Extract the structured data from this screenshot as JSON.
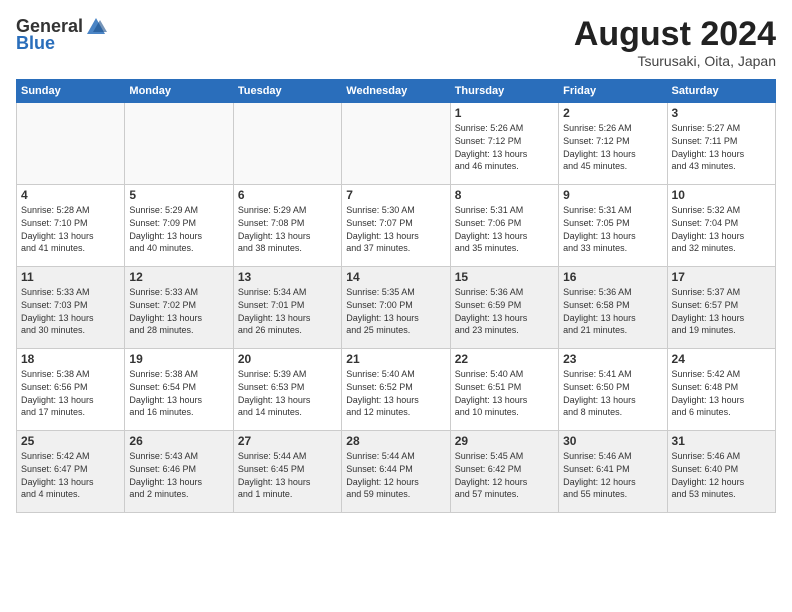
{
  "header": {
    "logo_general": "General",
    "logo_blue": "Blue",
    "month_title": "August 2024",
    "location": "Tsurusaki, Oita, Japan"
  },
  "weekdays": [
    "Sunday",
    "Monday",
    "Tuesday",
    "Wednesday",
    "Thursday",
    "Friday",
    "Saturday"
  ],
  "weeks": [
    [
      {
        "day": "",
        "empty": true
      },
      {
        "day": "",
        "empty": true
      },
      {
        "day": "",
        "empty": true
      },
      {
        "day": "",
        "empty": true
      },
      {
        "day": "1",
        "info": "Sunrise: 5:26 AM\nSunset: 7:12 PM\nDaylight: 13 hours\nand 46 minutes."
      },
      {
        "day": "2",
        "info": "Sunrise: 5:26 AM\nSunset: 7:12 PM\nDaylight: 13 hours\nand 45 minutes."
      },
      {
        "day": "3",
        "info": "Sunrise: 5:27 AM\nSunset: 7:11 PM\nDaylight: 13 hours\nand 43 minutes."
      }
    ],
    [
      {
        "day": "4",
        "info": "Sunrise: 5:28 AM\nSunset: 7:10 PM\nDaylight: 13 hours\nand 41 minutes."
      },
      {
        "day": "5",
        "info": "Sunrise: 5:29 AM\nSunset: 7:09 PM\nDaylight: 13 hours\nand 40 minutes."
      },
      {
        "day": "6",
        "info": "Sunrise: 5:29 AM\nSunset: 7:08 PM\nDaylight: 13 hours\nand 38 minutes."
      },
      {
        "day": "7",
        "info": "Sunrise: 5:30 AM\nSunset: 7:07 PM\nDaylight: 13 hours\nand 37 minutes."
      },
      {
        "day": "8",
        "info": "Sunrise: 5:31 AM\nSunset: 7:06 PM\nDaylight: 13 hours\nand 35 minutes."
      },
      {
        "day": "9",
        "info": "Sunrise: 5:31 AM\nSunset: 7:05 PM\nDaylight: 13 hours\nand 33 minutes."
      },
      {
        "day": "10",
        "info": "Sunrise: 5:32 AM\nSunset: 7:04 PM\nDaylight: 13 hours\nand 32 minutes."
      }
    ],
    [
      {
        "day": "11",
        "info": "Sunrise: 5:33 AM\nSunset: 7:03 PM\nDaylight: 13 hours\nand 30 minutes."
      },
      {
        "day": "12",
        "info": "Sunrise: 5:33 AM\nSunset: 7:02 PM\nDaylight: 13 hours\nand 28 minutes."
      },
      {
        "day": "13",
        "info": "Sunrise: 5:34 AM\nSunset: 7:01 PM\nDaylight: 13 hours\nand 26 minutes."
      },
      {
        "day": "14",
        "info": "Sunrise: 5:35 AM\nSunset: 7:00 PM\nDaylight: 13 hours\nand 25 minutes."
      },
      {
        "day": "15",
        "info": "Sunrise: 5:36 AM\nSunset: 6:59 PM\nDaylight: 13 hours\nand 23 minutes."
      },
      {
        "day": "16",
        "info": "Sunrise: 5:36 AM\nSunset: 6:58 PM\nDaylight: 13 hours\nand 21 minutes."
      },
      {
        "day": "17",
        "info": "Sunrise: 5:37 AM\nSunset: 6:57 PM\nDaylight: 13 hours\nand 19 minutes."
      }
    ],
    [
      {
        "day": "18",
        "info": "Sunrise: 5:38 AM\nSunset: 6:56 PM\nDaylight: 13 hours\nand 17 minutes."
      },
      {
        "day": "19",
        "info": "Sunrise: 5:38 AM\nSunset: 6:54 PM\nDaylight: 13 hours\nand 16 minutes."
      },
      {
        "day": "20",
        "info": "Sunrise: 5:39 AM\nSunset: 6:53 PM\nDaylight: 13 hours\nand 14 minutes."
      },
      {
        "day": "21",
        "info": "Sunrise: 5:40 AM\nSunset: 6:52 PM\nDaylight: 13 hours\nand 12 minutes."
      },
      {
        "day": "22",
        "info": "Sunrise: 5:40 AM\nSunset: 6:51 PM\nDaylight: 13 hours\nand 10 minutes."
      },
      {
        "day": "23",
        "info": "Sunrise: 5:41 AM\nSunset: 6:50 PM\nDaylight: 13 hours\nand 8 minutes."
      },
      {
        "day": "24",
        "info": "Sunrise: 5:42 AM\nSunset: 6:48 PM\nDaylight: 13 hours\nand 6 minutes."
      }
    ],
    [
      {
        "day": "25",
        "info": "Sunrise: 5:42 AM\nSunset: 6:47 PM\nDaylight: 13 hours\nand 4 minutes."
      },
      {
        "day": "26",
        "info": "Sunrise: 5:43 AM\nSunset: 6:46 PM\nDaylight: 13 hours\nand 2 minutes."
      },
      {
        "day": "27",
        "info": "Sunrise: 5:44 AM\nSunset: 6:45 PM\nDaylight: 13 hours\nand 1 minute."
      },
      {
        "day": "28",
        "info": "Sunrise: 5:44 AM\nSunset: 6:44 PM\nDaylight: 12 hours\nand 59 minutes."
      },
      {
        "day": "29",
        "info": "Sunrise: 5:45 AM\nSunset: 6:42 PM\nDaylight: 12 hours\nand 57 minutes."
      },
      {
        "day": "30",
        "info": "Sunrise: 5:46 AM\nSunset: 6:41 PM\nDaylight: 12 hours\nand 55 minutes."
      },
      {
        "day": "31",
        "info": "Sunrise: 5:46 AM\nSunset: 6:40 PM\nDaylight: 12 hours\nand 53 minutes."
      }
    ]
  ]
}
